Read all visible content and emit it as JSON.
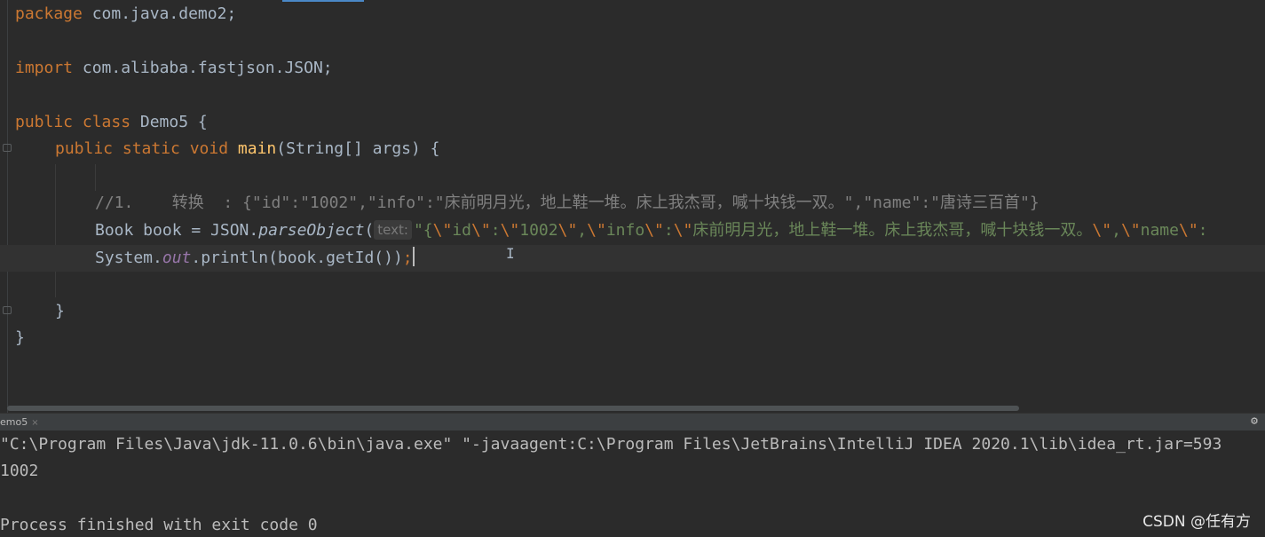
{
  "code": {
    "l1_kw": "package",
    "l1_rest": " com.java.demo2;",
    "l2_kw": "import",
    "l2_rest": " com.alibaba.fastjson.JSON;",
    "l3_kw": "public class",
    "l3_rest": " Demo5 {",
    "l4_kw": "public static void",
    "l4_fn": "main",
    "l4_rest": "(String[] args) {",
    "l5_comment_a": "//1.    ",
    "l5_comment_b": "转换",
    "l5_comment_c": "  : {\"id\":\"1002\",\"info\":\"",
    "l5_comment_d": "床前明月光，地上鞋一堆。床上我杰哥，喊十块钱一双。",
    "l5_comment_e": "\",\"name\":\"",
    "l5_comment_f": "唐诗三百首",
    "l5_comment_g": "\"}",
    "l6_a": "Book book = JSON.",
    "l6_method": "parseObject",
    "l6_paren": "(",
    "l6_hint": "text:",
    "l6_s1": "\"{",
    "l6_e1": "\\\"",
    "l6_s2": "id",
    "l6_e2": "\\\"",
    "l6_s3": ":",
    "l6_e3": "\\\"",
    "l6_s4": "1002",
    "l6_e4": "\\\"",
    "l6_s5": ",",
    "l6_e5": "\\\"",
    "l6_s6": "info",
    "l6_e6": "\\\"",
    "l6_s7": ":",
    "l6_e7": "\\\"",
    "l6_s8": "床前明月光，地上鞋一堆。床上我杰哥，喊十块钱一双。",
    "l6_e8": "\\\"",
    "l6_s9": ",",
    "l6_e9": "\\\"",
    "l6_s10": "name",
    "l6_e10": "\\\"",
    "l6_s11": ":",
    "l7_a": "System.",
    "l7_out": "out",
    "l7_b": ".println(book.getId())",
    "l7_semi": ";",
    "l8": "}",
    "l9": "}"
  },
  "run": {
    "tab_label": "emo5",
    "close_glyph": "×",
    "gear_glyph": "⚙"
  },
  "console": {
    "line1": "\"C:\\Program Files\\Java\\jdk-11.0.6\\bin\\java.exe\" \"-javaagent:C:\\Program Files\\JetBrains\\IntelliJ IDEA 2020.1\\lib\\idea_rt.jar=593",
    "line2": "1002",
    "line3": "Process finished with exit code 0"
  },
  "watermark": "CSDN @任有方"
}
